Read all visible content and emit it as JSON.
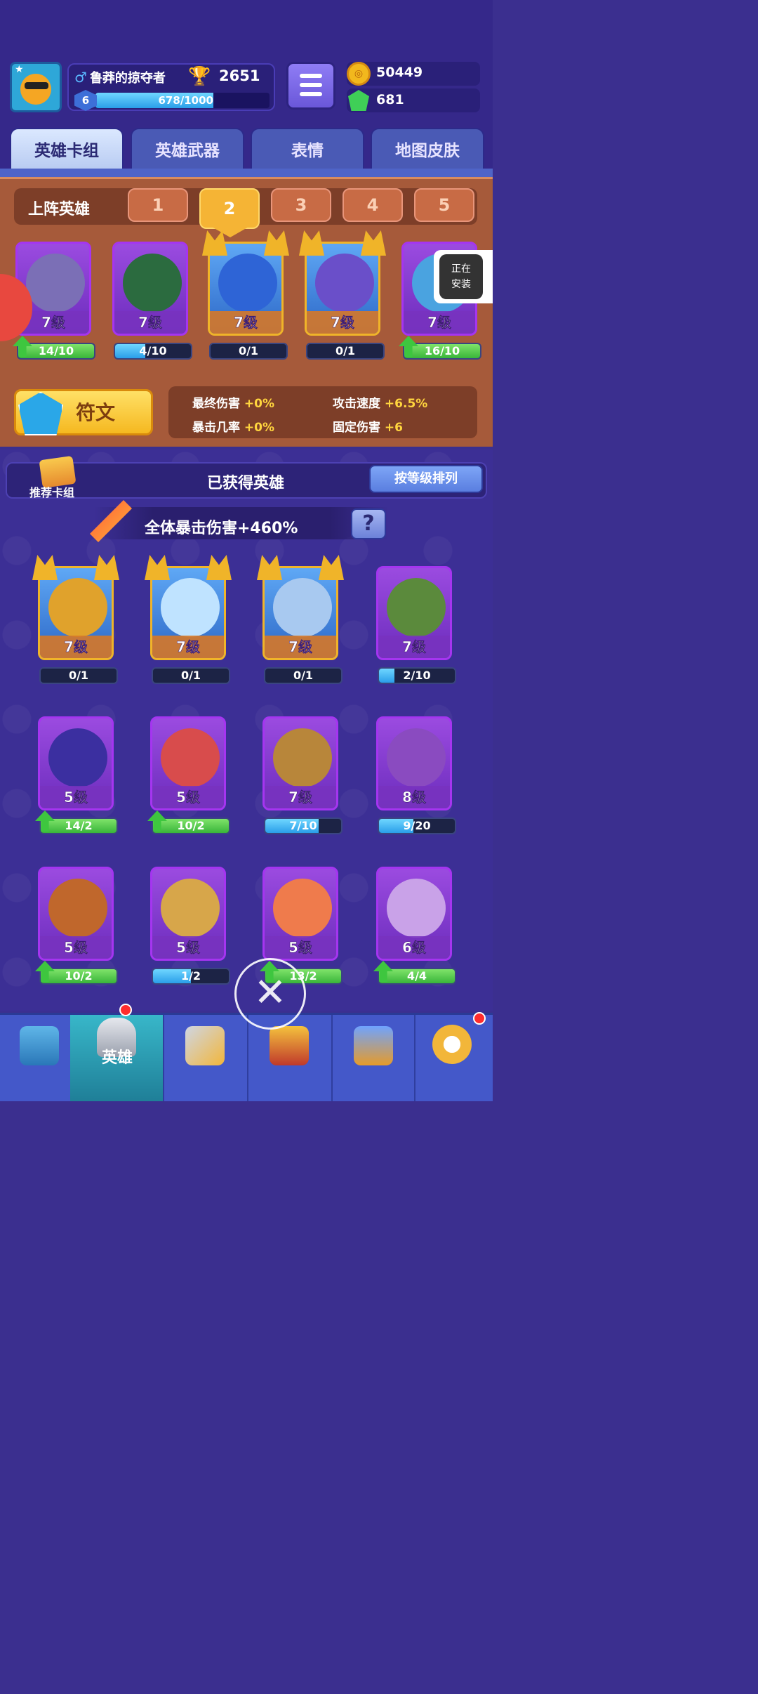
{
  "player": {
    "name": "鲁莽的掠夺者",
    "gender_symbol": "♂",
    "trophies": "2651",
    "level": "6",
    "xp_text": "678/1000",
    "xp_fraction": 0.678
  },
  "currency": {
    "coins": "50449",
    "gems": "681"
  },
  "tabs": [
    {
      "label": "英雄卡组",
      "active": true
    },
    {
      "label": "英雄武器",
      "active": false
    },
    {
      "label": "表情",
      "active": false
    },
    {
      "label": "地图皮肤",
      "active": false
    }
  ],
  "lineup": {
    "label": "上阵英雄",
    "slots": [
      "1",
      "2",
      "3",
      "4",
      "5"
    ],
    "active_slot": "2",
    "heroes": [
      {
        "level": "7级",
        "progress": "14/10",
        "fraction": 1.0,
        "upgrade": true,
        "rarity": "epic",
        "color": "#7b6fb6"
      },
      {
        "level": "7级",
        "progress": "4/10",
        "fraction": 0.4,
        "upgrade": false,
        "rarity": "epic",
        "color": "#2b6b3f"
      },
      {
        "level": "7级",
        "progress": "0/1",
        "fraction": 0.0,
        "upgrade": false,
        "rarity": "legend",
        "color": "#2e64d6"
      },
      {
        "level": "7级",
        "progress": "0/1",
        "fraction": 0.0,
        "upgrade": false,
        "rarity": "legend",
        "color": "#6a4fc9"
      },
      {
        "level": "7级",
        "progress": "16/10",
        "fraction": 1.0,
        "upgrade": true,
        "rarity": "epic",
        "color": "#4aa3e0"
      }
    ]
  },
  "runes": {
    "label": "符文",
    "stats": [
      {
        "name": "最终伤害",
        "value": "+0%"
      },
      {
        "name": "攻击速度",
        "value": "+6.5%"
      },
      {
        "name": "暴击几率",
        "value": "+0%"
      },
      {
        "name": "固定伤害",
        "value": "+6"
      }
    ]
  },
  "collection": {
    "recommend_label": "推荐卡组",
    "title": "已获得英雄",
    "sort_label": "按等级排列",
    "crit_text": "全体暴击伤害+460%",
    "help_symbol": "?",
    "heroes": [
      {
        "level": "7级",
        "progress": "0/1",
        "fraction": 0.0,
        "upgrade": false,
        "rarity": "legend",
        "color": "#e0a22c"
      },
      {
        "level": "7级",
        "progress": "0/1",
        "fraction": 0.0,
        "upgrade": false,
        "rarity": "legend",
        "color": "#bfe3ff"
      },
      {
        "level": "7级",
        "progress": "0/1",
        "fraction": 0.0,
        "upgrade": false,
        "rarity": "legend",
        "color": "#a8c9f0"
      },
      {
        "level": "7级",
        "progress": "2/10",
        "fraction": 0.2,
        "upgrade": false,
        "rarity": "epic",
        "color": "#5b8a3c"
      },
      {
        "level": "5级",
        "progress": "14/2",
        "fraction": 1.0,
        "upgrade": true,
        "rarity": "epic",
        "color": "#3b2fa0"
      },
      {
        "level": "5级",
        "progress": "10/2",
        "fraction": 1.0,
        "upgrade": true,
        "rarity": "epic",
        "color": "#d84c4c"
      },
      {
        "level": "7级",
        "progress": "7/10",
        "fraction": 0.7,
        "upgrade": false,
        "rarity": "epic",
        "color": "#b8863a"
      },
      {
        "level": "8级",
        "progress": "9/20",
        "fraction": 0.45,
        "upgrade": false,
        "rarity": "epic",
        "color": "#8a4bc0"
      },
      {
        "level": "5级",
        "progress": "10/2",
        "fraction": 1.0,
        "upgrade": true,
        "rarity": "epic",
        "color": "#c0672c"
      },
      {
        "level": "5级",
        "progress": "1/2",
        "fraction": 0.5,
        "upgrade": false,
        "rarity": "epic",
        "color": "#d7a64a"
      },
      {
        "level": "5级",
        "progress": "13/2",
        "fraction": 1.0,
        "upgrade": true,
        "rarity": "epic",
        "color": "#ef7b4c"
      },
      {
        "level": "6级",
        "progress": "4/4",
        "fraction": 1.0,
        "upgrade": true,
        "rarity": "epic",
        "color": "#c9a2e8"
      }
    ]
  },
  "install_popup": {
    "line1": "正在",
    "line2": "安装"
  },
  "close_symbol": "✕",
  "nav": [
    {
      "label": "",
      "icon": "treasure-chest-icon"
    },
    {
      "label": "英雄",
      "icon": "knight-helmet-icon",
      "active": true
    },
    {
      "label": "",
      "icon": "crossed-swords-icon"
    },
    {
      "label": "",
      "icon": "crown-shield-icon"
    },
    {
      "label": "",
      "icon": "team-banner-icon"
    },
    {
      "label": "",
      "icon": "compass-icon",
      "badge": true
    }
  ]
}
